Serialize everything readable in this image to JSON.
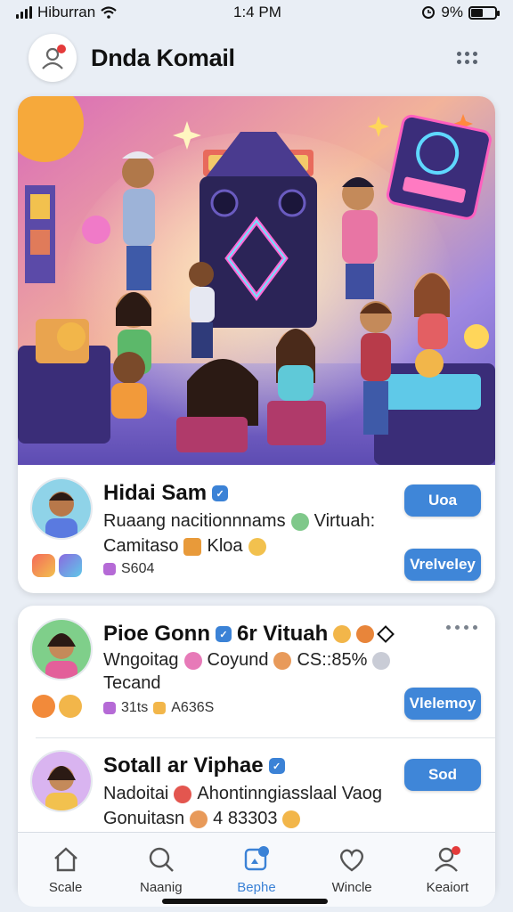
{
  "status": {
    "carrier": "Hiburran",
    "time": "1:4 PM",
    "battery": "9%"
  },
  "header": {
    "title": "Dnda Komail"
  },
  "posts": [
    {
      "name": "Hidai Sam",
      "line1": "Ruaang nacitionnnams",
      "line1b": "Virtuah:",
      "line2": "Camitaso",
      "line2b": "Kloa",
      "meta": "S604",
      "button_top": "Uoa",
      "button_bottom": "Vrelveley"
    },
    {
      "name": "Pioe Gonn",
      "name_b": "6r Vituah",
      "line1": "Wngoitag",
      "line1b": "Coyund",
      "line1c": "CS::85%",
      "line2": "Tecand",
      "meta": "31ts",
      "meta_b": "A636S",
      "button": "Vlelemoy"
    },
    {
      "name": "Sotall ar Viphae",
      "line1": "Nadoitai",
      "line1b": "Ahontinngiasslaal Vaog",
      "line2": "Gonuitasn",
      "line2b": "4 83303",
      "button": "Sod"
    }
  ],
  "nav": {
    "items": [
      {
        "label": "Scale",
        "icon": "home-icon"
      },
      {
        "label": "Naanig",
        "icon": "search-icon"
      },
      {
        "label": "Bephe",
        "icon": "create-post-icon",
        "active": true
      },
      {
        "label": "Wincle",
        "icon": "heart-icon"
      },
      {
        "label": "Keaiort",
        "icon": "profile-icon"
      }
    ]
  },
  "colors": {
    "accent": "#3f86d8",
    "background": "#e9eef5",
    "card": "#ffffff"
  }
}
